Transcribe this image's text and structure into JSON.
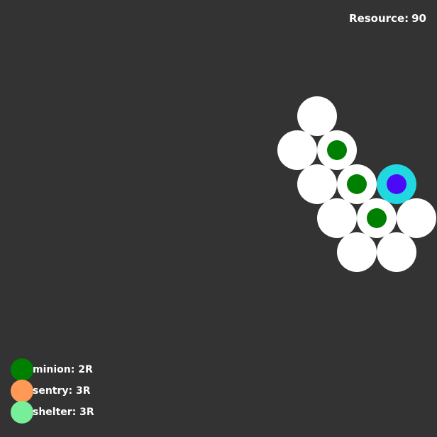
{
  "hud": {
    "resource_label": "Resource:",
    "resource_value": "90"
  },
  "colors": {
    "background": "#333333",
    "empty_cell": "#ffffff",
    "unit_minion": "#008000",
    "player_ring": "#22d8e0",
    "player_core": "#4a0af5"
  },
  "board": {
    "cells": [
      {
        "q": 0,
        "r": -2,
        "unit": "empty"
      },
      {
        "q": -1,
        "r": -1,
        "unit": "empty"
      },
      {
        "q": 0,
        "r": -1,
        "unit": "minion"
      },
      {
        "q": -1,
        "r": 0,
        "unit": "empty"
      },
      {
        "q": 0,
        "r": 0,
        "unit": "minion"
      },
      {
        "q": 1,
        "r": 0,
        "unit": "player"
      },
      {
        "q": -1,
        "r": 1,
        "unit": "empty"
      },
      {
        "q": 0,
        "r": 1,
        "unit": "minion"
      },
      {
        "q": 1,
        "r": 1,
        "unit": "empty"
      },
      {
        "q": -1,
        "r": 2,
        "unit": "empty"
      },
      {
        "q": 0,
        "r": 2,
        "unit": "empty"
      }
    ]
  },
  "legend": [
    {
      "name": "minion",
      "cost": "2R",
      "color": "#008000"
    },
    {
      "name": "sentry",
      "cost": "3R",
      "color": "#ff9955"
    },
    {
      "name": "shelter",
      "cost": "3R",
      "color": "#77ee99"
    }
  ]
}
